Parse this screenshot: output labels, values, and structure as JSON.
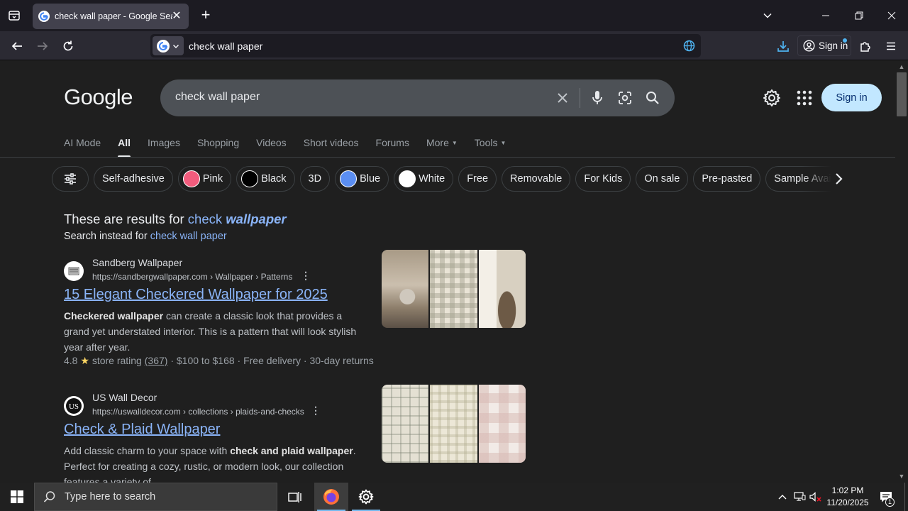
{
  "browser": {
    "tab_title": "check wall paper - Google Search",
    "tab_close": "✕",
    "new_tab": "+",
    "url_text": "check wall paper",
    "signin_label": "Sign in"
  },
  "google": {
    "logo": "Google",
    "query": "check wall paper",
    "signin_label": "Sign in",
    "tabs": [
      {
        "label": "AI Mode"
      },
      {
        "label": "All"
      },
      {
        "label": "Images"
      },
      {
        "label": "Shopping"
      },
      {
        "label": "Videos"
      },
      {
        "label": "Short videos"
      },
      {
        "label": "Forums"
      },
      {
        "label": "More"
      },
      {
        "label": "Tools"
      }
    ],
    "chips": [
      {
        "label": "Self-adhesive",
        "swatch": ""
      },
      {
        "label": "Pink",
        "swatch": "#f25c7d"
      },
      {
        "label": "Black",
        "swatch": "#000000"
      },
      {
        "label": "3D",
        "swatch": ""
      },
      {
        "label": "Blue",
        "swatch": "#5b8ef2"
      },
      {
        "label": "White",
        "swatch": "#ffffff"
      },
      {
        "label": "Free",
        "swatch": ""
      },
      {
        "label": "Removable",
        "swatch": ""
      },
      {
        "label": "For Kids",
        "swatch": ""
      },
      {
        "label": "On sale",
        "swatch": ""
      },
      {
        "label": "Pre-pasted",
        "swatch": ""
      },
      {
        "label": "Sample Available",
        "swatch": ""
      }
    ],
    "correction": {
      "prefix": "These are results for",
      "word1": "check",
      "word2": "wallpaper",
      "instead_prefix": "Search instead for",
      "instead_link": "check wall paper"
    },
    "results": [
      {
        "site": "Sandberg Wallpaper",
        "url": "https://sandbergwallpaper.com › Wallpaper › Patterns",
        "title": "15 Elegant Checkered Wallpaper for 2025",
        "snippet_bold": "Checkered wallpaper",
        "snippet_rest": " can create a classic look that provides a grand yet understated interior. This is a pattern that will look stylish year after year.",
        "rating": "4.8",
        "rating_label": "store rating",
        "reviews": "(367)",
        "price": "$100 to $168",
        "delivery": "Free delivery",
        "returns": "30-day returns"
      },
      {
        "site": "US Wall Decor",
        "url": "https://uswalldecor.com › collections › plaids-and-checks",
        "title": "Check & Plaid Wallpaper",
        "snippet_pre": "Add classic charm to your space with ",
        "snippet_bold": "check and plaid wallpaper",
        "snippet_rest": ". Perfect for creating a cozy, rustic, or modern look, our collection features a variety of ..."
      }
    ]
  },
  "taskbar": {
    "search_placeholder": "Type here to search",
    "time": "1:02 PM",
    "date": "11/20/2025",
    "notif_count": "1"
  }
}
